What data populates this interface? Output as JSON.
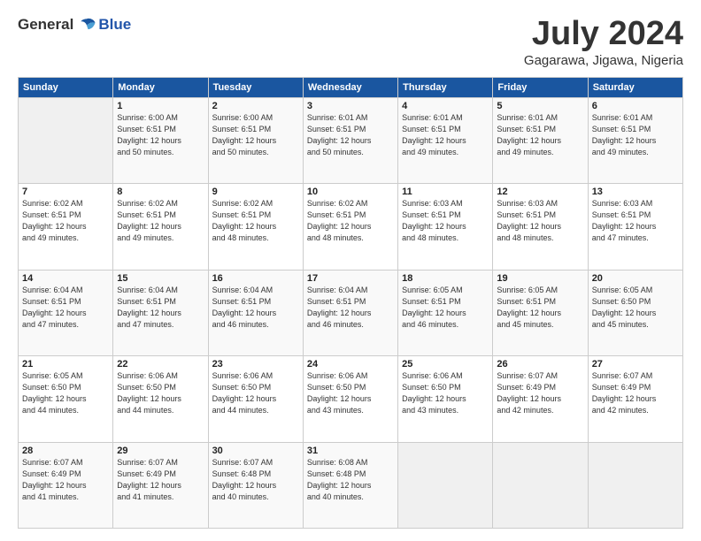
{
  "logo": {
    "general": "General",
    "blue": "Blue"
  },
  "header": {
    "title": "July 2024",
    "subtitle": "Gagarawa, Jigawa, Nigeria"
  },
  "days_of_week": [
    "Sunday",
    "Monday",
    "Tuesday",
    "Wednesday",
    "Thursday",
    "Friday",
    "Saturday"
  ],
  "weeks": [
    [
      {
        "day": "",
        "info": ""
      },
      {
        "day": "1",
        "info": "Sunrise: 6:00 AM\nSunset: 6:51 PM\nDaylight: 12 hours\nand 50 minutes."
      },
      {
        "day": "2",
        "info": "Sunrise: 6:00 AM\nSunset: 6:51 PM\nDaylight: 12 hours\nand 50 minutes."
      },
      {
        "day": "3",
        "info": "Sunrise: 6:01 AM\nSunset: 6:51 PM\nDaylight: 12 hours\nand 50 minutes."
      },
      {
        "day": "4",
        "info": "Sunrise: 6:01 AM\nSunset: 6:51 PM\nDaylight: 12 hours\nand 49 minutes."
      },
      {
        "day": "5",
        "info": "Sunrise: 6:01 AM\nSunset: 6:51 PM\nDaylight: 12 hours\nand 49 minutes."
      },
      {
        "day": "6",
        "info": "Sunrise: 6:01 AM\nSunset: 6:51 PM\nDaylight: 12 hours\nand 49 minutes."
      }
    ],
    [
      {
        "day": "7",
        "info": "Sunrise: 6:02 AM\nSunset: 6:51 PM\nDaylight: 12 hours\nand 49 minutes."
      },
      {
        "day": "8",
        "info": "Sunrise: 6:02 AM\nSunset: 6:51 PM\nDaylight: 12 hours\nand 49 minutes."
      },
      {
        "day": "9",
        "info": "Sunrise: 6:02 AM\nSunset: 6:51 PM\nDaylight: 12 hours\nand 48 minutes."
      },
      {
        "day": "10",
        "info": "Sunrise: 6:02 AM\nSunset: 6:51 PM\nDaylight: 12 hours\nand 48 minutes."
      },
      {
        "day": "11",
        "info": "Sunrise: 6:03 AM\nSunset: 6:51 PM\nDaylight: 12 hours\nand 48 minutes."
      },
      {
        "day": "12",
        "info": "Sunrise: 6:03 AM\nSunset: 6:51 PM\nDaylight: 12 hours\nand 48 minutes."
      },
      {
        "day": "13",
        "info": "Sunrise: 6:03 AM\nSunset: 6:51 PM\nDaylight: 12 hours\nand 47 minutes."
      }
    ],
    [
      {
        "day": "14",
        "info": "Sunrise: 6:04 AM\nSunset: 6:51 PM\nDaylight: 12 hours\nand 47 minutes."
      },
      {
        "day": "15",
        "info": "Sunrise: 6:04 AM\nSunset: 6:51 PM\nDaylight: 12 hours\nand 47 minutes."
      },
      {
        "day": "16",
        "info": "Sunrise: 6:04 AM\nSunset: 6:51 PM\nDaylight: 12 hours\nand 46 minutes."
      },
      {
        "day": "17",
        "info": "Sunrise: 6:04 AM\nSunset: 6:51 PM\nDaylight: 12 hours\nand 46 minutes."
      },
      {
        "day": "18",
        "info": "Sunrise: 6:05 AM\nSunset: 6:51 PM\nDaylight: 12 hours\nand 46 minutes."
      },
      {
        "day": "19",
        "info": "Sunrise: 6:05 AM\nSunset: 6:51 PM\nDaylight: 12 hours\nand 45 minutes."
      },
      {
        "day": "20",
        "info": "Sunrise: 6:05 AM\nSunset: 6:50 PM\nDaylight: 12 hours\nand 45 minutes."
      }
    ],
    [
      {
        "day": "21",
        "info": "Sunrise: 6:05 AM\nSunset: 6:50 PM\nDaylight: 12 hours\nand 44 minutes."
      },
      {
        "day": "22",
        "info": "Sunrise: 6:06 AM\nSunset: 6:50 PM\nDaylight: 12 hours\nand 44 minutes."
      },
      {
        "day": "23",
        "info": "Sunrise: 6:06 AM\nSunset: 6:50 PM\nDaylight: 12 hours\nand 44 minutes."
      },
      {
        "day": "24",
        "info": "Sunrise: 6:06 AM\nSunset: 6:50 PM\nDaylight: 12 hours\nand 43 minutes."
      },
      {
        "day": "25",
        "info": "Sunrise: 6:06 AM\nSunset: 6:50 PM\nDaylight: 12 hours\nand 43 minutes."
      },
      {
        "day": "26",
        "info": "Sunrise: 6:07 AM\nSunset: 6:49 PM\nDaylight: 12 hours\nand 42 minutes."
      },
      {
        "day": "27",
        "info": "Sunrise: 6:07 AM\nSunset: 6:49 PM\nDaylight: 12 hours\nand 42 minutes."
      }
    ],
    [
      {
        "day": "28",
        "info": "Sunrise: 6:07 AM\nSunset: 6:49 PM\nDaylight: 12 hours\nand 41 minutes."
      },
      {
        "day": "29",
        "info": "Sunrise: 6:07 AM\nSunset: 6:49 PM\nDaylight: 12 hours\nand 41 minutes."
      },
      {
        "day": "30",
        "info": "Sunrise: 6:07 AM\nSunset: 6:48 PM\nDaylight: 12 hours\nand 40 minutes."
      },
      {
        "day": "31",
        "info": "Sunrise: 6:08 AM\nSunset: 6:48 PM\nDaylight: 12 hours\nand 40 minutes."
      },
      {
        "day": "",
        "info": ""
      },
      {
        "day": "",
        "info": ""
      },
      {
        "day": "",
        "info": ""
      }
    ]
  ]
}
